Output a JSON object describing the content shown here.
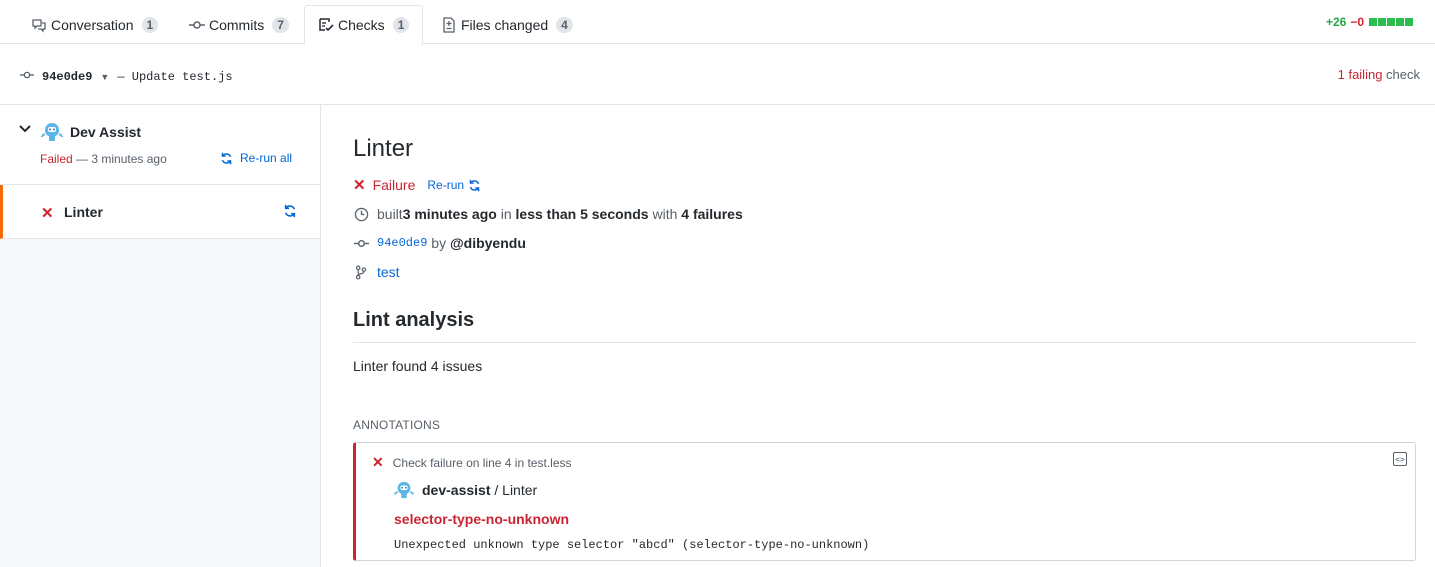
{
  "tabs": [
    {
      "label": "Conversation",
      "count": "1",
      "icon": "comment-discussion-icon"
    },
    {
      "label": "Commits",
      "count": "7",
      "icon": "git-commit-icon"
    },
    {
      "label": "Checks",
      "count": "1",
      "icon": "checklist-icon",
      "active": true
    },
    {
      "label": "Files changed",
      "count": "4",
      "icon": "file-diff-icon"
    }
  ],
  "diffstat": {
    "additions": "+26",
    "deletions": "−0"
  },
  "commit": {
    "sha": "94e0de9",
    "message": "— Update test.js"
  },
  "failing": {
    "count": "1 failing",
    "suffix": " check"
  },
  "suite": {
    "name": "Dev Assist",
    "status": "Failed",
    "time": " — 3 minutes ago",
    "rerun_all": "Re-run all"
  },
  "run": {
    "name": "Linter"
  },
  "detail": {
    "title": "Linter",
    "conclusion": "Failure",
    "rerun": "Re-run",
    "built_prefix": "built ",
    "built_time": "3 minutes ago",
    "built_in": " in ",
    "duration": "less than 5 seconds",
    "built_with": " with ",
    "failures": "4 failures",
    "sha": "94e0de9",
    "by": " by ",
    "author": "@dibyendu",
    "branch": "test",
    "section_title": "Lint analysis",
    "summary": "Linter found 4 issues",
    "annotations_header": "ANNOTATIONS"
  },
  "annotation": {
    "title": "Check failure on line 4 in test.less",
    "app": "dev-assist",
    "check": " / Linter",
    "rule": "selector-type-no-unknown",
    "message": "Unexpected unknown type selector \"abcd\" (selector-type-no-unknown)"
  },
  "colors": {
    "failure": "#cb2431",
    "link": "#0366d6",
    "accent": "#f66a0a",
    "add": "#28a745"
  }
}
